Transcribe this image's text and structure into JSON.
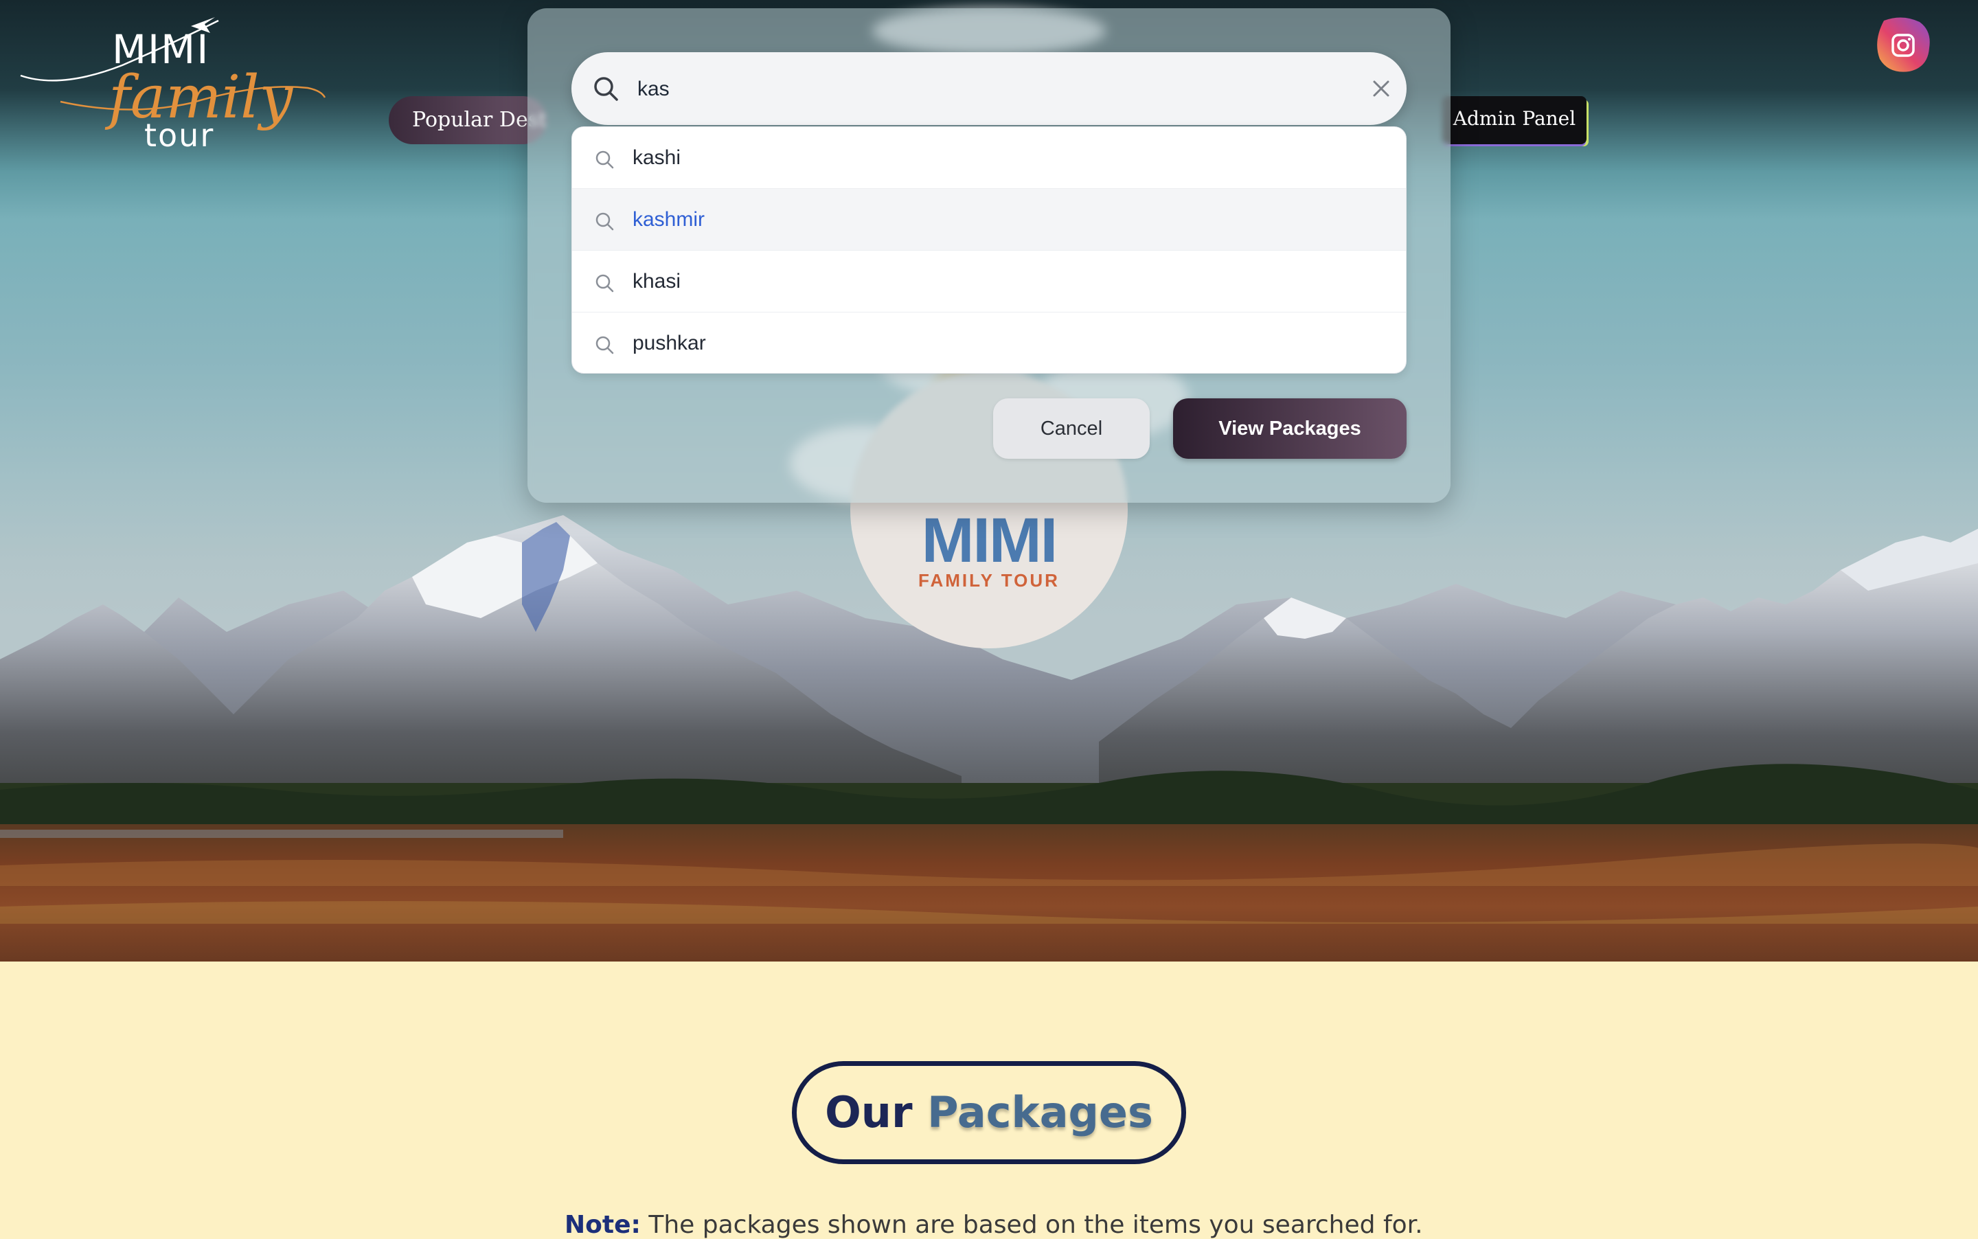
{
  "header": {
    "logo": {
      "line1": "MIMI",
      "line2": "family",
      "line3": "tour"
    },
    "nav_visible_label": "Popular Dest",
    "admin_label": "Admin Panel",
    "instagram_icon": "instagram-icon"
  },
  "hero": {
    "brand_name": "MIMI",
    "brand_sub": "FAMILY TOUR"
  },
  "search_modal": {
    "query": "kas",
    "suggestions": [
      "kashi",
      "kashmir",
      "khasi",
      "pushkar"
    ],
    "active_index": 1,
    "cancel_label": "Cancel",
    "view_label": "View Packages"
  },
  "packages": {
    "title_word1": "Our",
    "title_word2": "Packages",
    "note_label": "Note:",
    "note_text": " The packages shown are based on the items you searched for."
  },
  "colors": {
    "accent_dark": "#2d1f2f",
    "link_active": "#2f5fd4",
    "brand_blue": "#4c7bb0",
    "brand_orange": "#d0633a",
    "packages_bg": "#fdf1c4"
  }
}
